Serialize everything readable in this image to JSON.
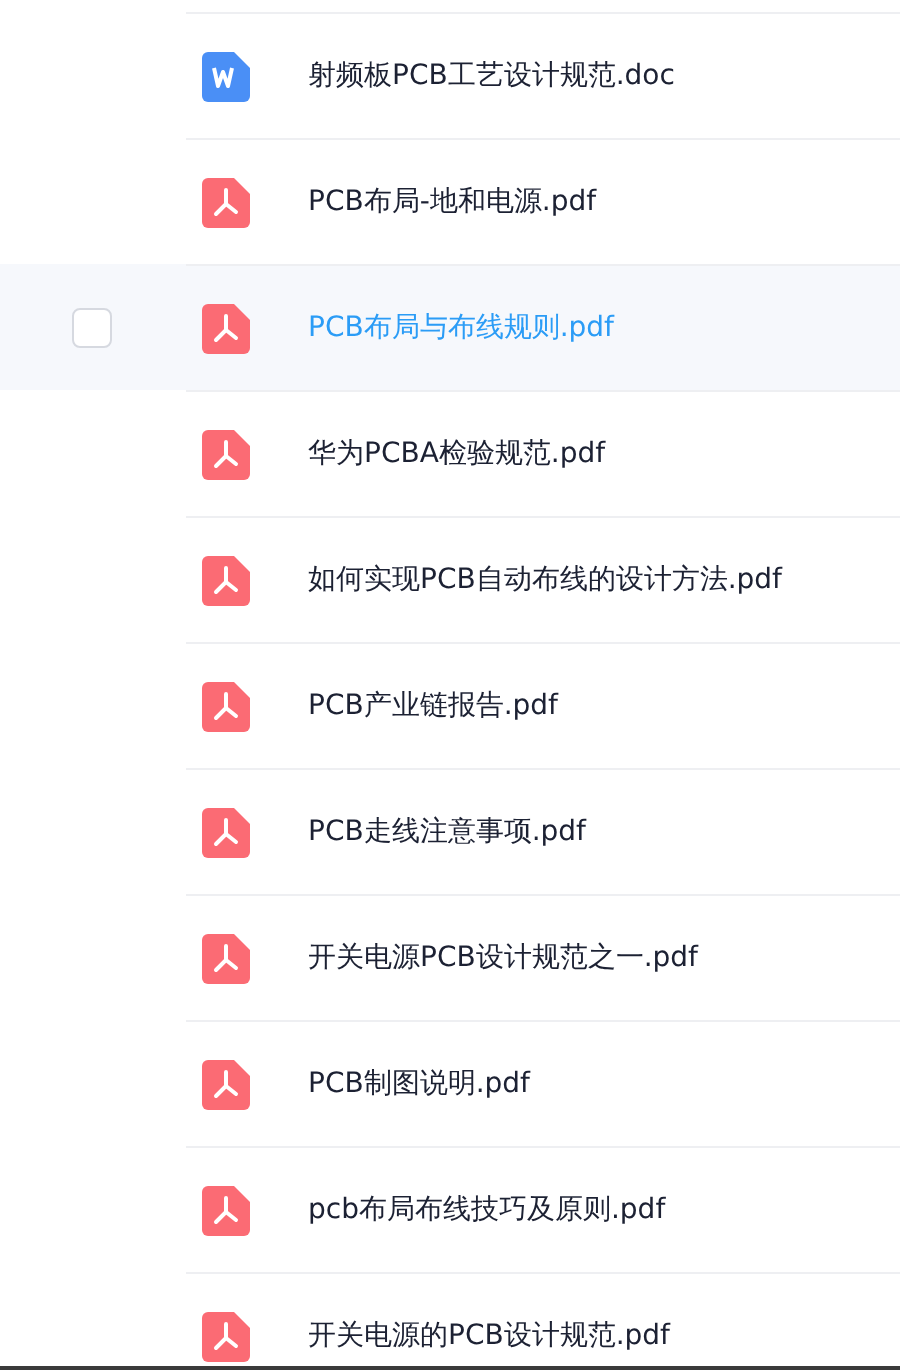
{
  "files": [
    {
      "name": "射频板PCB工艺设计规范.doc",
      "kind": "doc",
      "selected": false
    },
    {
      "name": "PCB布局-地和电源.pdf",
      "kind": "pdf",
      "selected": false
    },
    {
      "name": "PCB布局与布线规则.pdf",
      "kind": "pdf",
      "selected": true,
      "checked": false
    },
    {
      "name": "华为PCBA检验规范.pdf",
      "kind": "pdf",
      "selected": false
    },
    {
      "name": "如何实现PCB自动布线的设计方法.pdf",
      "kind": "pdf",
      "selected": false
    },
    {
      "name": "PCB产业链报告.pdf",
      "kind": "pdf",
      "selected": false
    },
    {
      "name": "PCB走线注意事项.pdf",
      "kind": "pdf",
      "selected": false
    },
    {
      "name": "开关电源PCB设计规范之一.pdf",
      "kind": "pdf",
      "selected": false
    },
    {
      "name": "PCB制图说明.pdf",
      "kind": "pdf",
      "selected": false
    },
    {
      "name": "pcb布局布线技巧及原则.pdf",
      "kind": "pdf",
      "selected": false
    },
    {
      "name": "开关电源的PCB设计规范.pdf",
      "kind": "pdf",
      "selected": false
    }
  ]
}
